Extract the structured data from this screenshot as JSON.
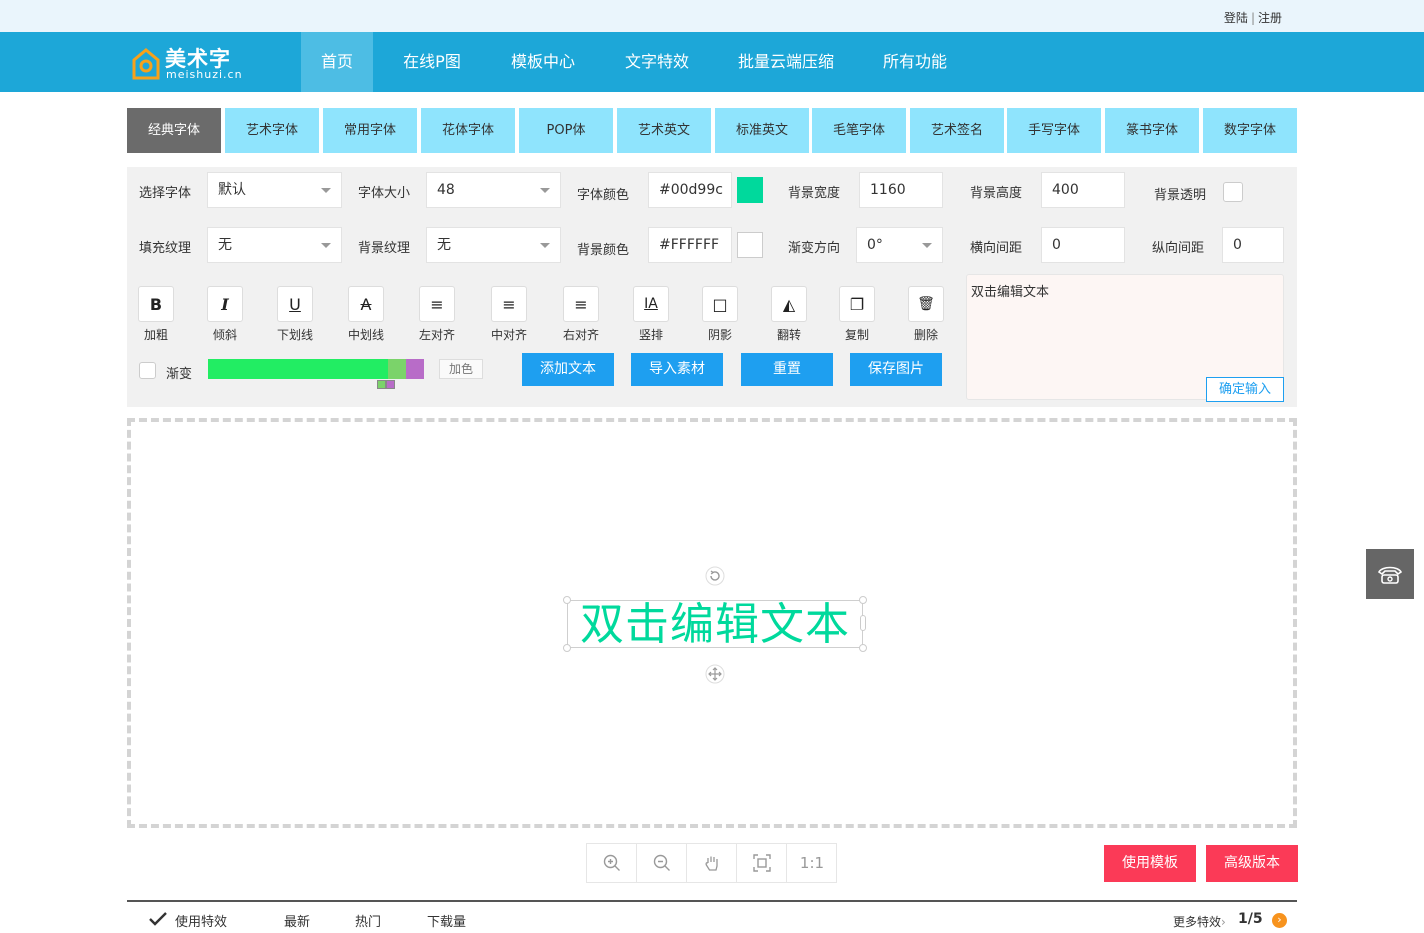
{
  "auth": {
    "login": "登陆",
    "separator": "|",
    "register": "注册"
  },
  "logo": {
    "cn": "美术字",
    "en": "meishuzi.cn"
  },
  "nav": [
    "首页",
    "在线P图",
    "模板中心",
    "文字特效",
    "批量云端压缩",
    "所有功能"
  ],
  "font_tabs": [
    "经典字体",
    "艺术字体",
    "常用字体",
    "花体字体",
    "POP体",
    "艺术英文",
    "标准英文",
    "毛笔字体",
    "艺术签名",
    "手写字体",
    "篆书字体",
    "数字字体"
  ],
  "controls": {
    "font_label": "选择字体",
    "font_value": "默认",
    "size_label": "字体大小",
    "size_value": "48",
    "color_label": "字体颜色",
    "color_value": "#00d99c",
    "bg_width_label": "背景宽度",
    "bg_width_value": "1160",
    "bg_height_label": "背景高度",
    "bg_height_value": "400",
    "bg_transparent_label": "背景透明",
    "fill_label": "填充纹理",
    "fill_value": "无",
    "bg_texture_label": "背景纹理",
    "bg_texture_value": "无",
    "bg_color_label": "背景颜色",
    "bg_color_value": "#FFFFFF",
    "gradient_dir_label": "渐变方向",
    "gradient_dir_value": "0°",
    "h_spacing_label": "横向间距",
    "h_spacing_value": "0",
    "v_spacing_label": "纵向间距",
    "v_spacing_value": "0"
  },
  "tools": [
    {
      "icon": "B",
      "label": "加粗"
    },
    {
      "icon": "I",
      "label": "倾斜"
    },
    {
      "icon": "U",
      "label": "下划线"
    },
    {
      "icon": "A",
      "label": "中划线"
    },
    {
      "icon": "≡",
      "label": "左对齐"
    },
    {
      "icon": "≡",
      "label": "中对齐"
    },
    {
      "icon": "≡",
      "label": "右对齐"
    },
    {
      "icon": "IA",
      "label": "竖排"
    },
    {
      "icon": "□",
      "label": "阴影"
    },
    {
      "icon": "◭",
      "label": "翻转"
    },
    {
      "icon": "❐",
      "label": "复制"
    },
    {
      "icon": "🗑",
      "label": "删除"
    }
  ],
  "gradient": {
    "label": "渐变",
    "add_color": "加色"
  },
  "actions": [
    "添加文本",
    "导入素材",
    "重置",
    "保存图片"
  ],
  "text_input": {
    "value": "双击编辑文本",
    "confirm": "确定输入"
  },
  "canvas": {
    "text": "双击编辑文本"
  },
  "zoom": {
    "ratio": "1:1"
  },
  "buttons": {
    "use_template": "使用模板",
    "advanced": "高级版本"
  },
  "bottom_tabs": [
    "使用特效",
    "最新",
    "热门",
    "下载量"
  ],
  "pager": {
    "more": "更多特效",
    "page": "1/5"
  },
  "colors": {
    "accent": "#1da7d8",
    "text_color": "#00d99c",
    "red": "#fb3a57"
  }
}
